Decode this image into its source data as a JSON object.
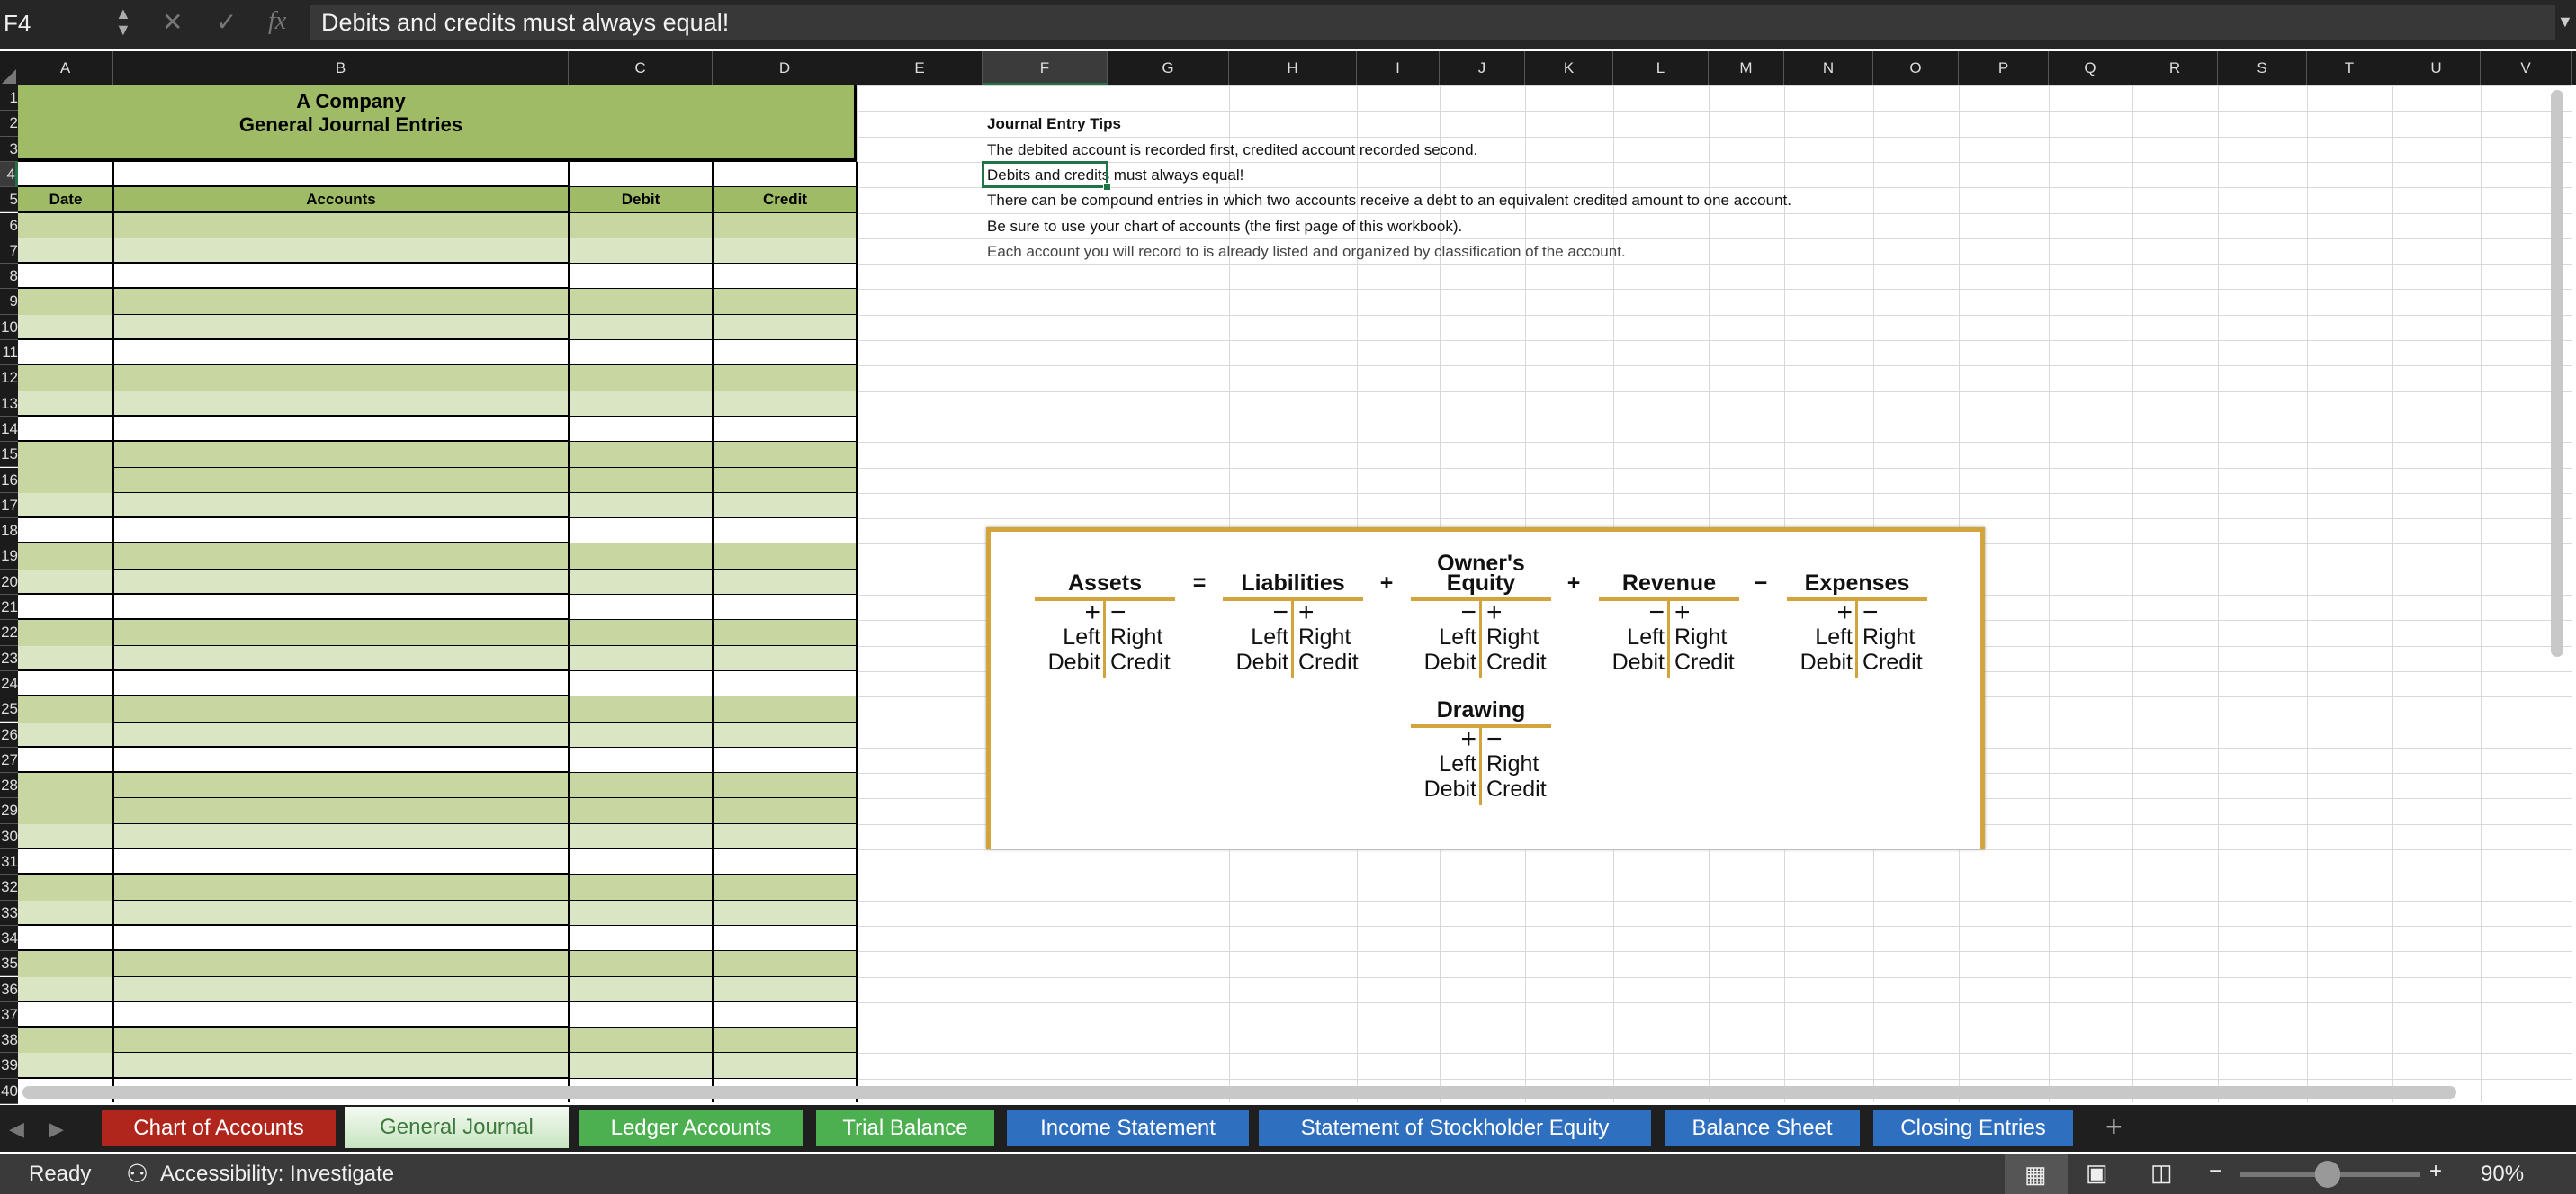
{
  "formula_bar": {
    "name_box": "F4",
    "cancel_icon": "x-icon",
    "enter_icon": "check-icon",
    "fx_label": "fx",
    "formula": "Debits and credits must always equal!"
  },
  "columns": [
    "A",
    "B",
    "C",
    "D",
    "E",
    "F",
    "G",
    "H",
    "I",
    "J",
    "K",
    "L",
    "M",
    "N",
    "O",
    "P",
    "Q",
    "R",
    "S",
    "T",
    "U",
    "V"
  ],
  "rows": [
    "1",
    "2",
    "3",
    "4",
    "5",
    "6",
    "7",
    "8",
    "9",
    "10",
    "11",
    "12",
    "13",
    "14",
    "15",
    "16",
    "17",
    "18",
    "19",
    "20",
    "21",
    "22",
    "23",
    "24",
    "25",
    "26",
    "27",
    "28",
    "29",
    "30",
    "31",
    "32",
    "33",
    "34",
    "35",
    "36",
    "37",
    "38",
    "39",
    "40"
  ],
  "selected_cell": "F4",
  "journal": {
    "company": "A Company",
    "title": "General Journal Entries",
    "headers": {
      "date": "Date",
      "accounts": "Accounts",
      "debit": "Debit",
      "credit": "Credit"
    }
  },
  "colors": {
    "header_green": "#9fbb66",
    "dark_green": "#c8d7a2",
    "light_green": "#dae5c3",
    "selection": "#217346",
    "gold": "#d4a43c"
  },
  "tips": {
    "heading": "Journal Entry Tips",
    "lines": [
      "The debited account is recorded first, credited account recorded second.",
      "Debits and credits must always equal!",
      "There can be compound entries in which two accounts receive a debt to an equivalent credited amount to one account.",
      "Be sure to use your chart of accounts (the first page of this workbook).",
      "Each account you will record to is already listed and organized by classification of the account."
    ]
  },
  "diagram": {
    "accounts": [
      {
        "name": "Assets",
        "left_sign": "+",
        "right_sign": "−",
        "left": "Left",
        "right": "Right",
        "left_side": "Debit",
        "right_side": "Credit"
      },
      {
        "name": "Liabilities",
        "left_sign": "−",
        "right_sign": "+",
        "left": "Left",
        "right": "Right",
        "left_side": "Debit",
        "right_side": "Credit"
      },
      {
        "name_line1": "Owner's",
        "name": "Equity",
        "left_sign": "−",
        "right_sign": "+",
        "left": "Left",
        "right": "Right",
        "left_side": "Debit",
        "right_side": "Credit"
      },
      {
        "name": "Revenue",
        "left_sign": "−",
        "right_sign": "+",
        "left": "Left",
        "right": "Right",
        "left_side": "Debit",
        "right_side": "Credit"
      },
      {
        "name": "Expenses",
        "left_sign": "+",
        "right_sign": "−",
        "left": "Left",
        "right": "Right",
        "left_side": "Debit",
        "right_side": "Credit"
      },
      {
        "name": "Drawing",
        "left_sign": "+",
        "right_sign": "−",
        "left": "Left",
        "right": "Right",
        "left_side": "Debit",
        "right_side": "Credit"
      }
    ],
    "operators": [
      "=",
      "+",
      "+",
      "−"
    ]
  },
  "sheet_tabs": [
    {
      "label": "Chart of Accounts",
      "color": "#b0261c",
      "active": false
    },
    {
      "label": "General Journal",
      "color": "#cfe8c9",
      "active": true
    },
    {
      "label": "Ledger Accounts",
      "color": "#4caf50",
      "active": false
    },
    {
      "label": "Trial Balance",
      "color": "#4caf50",
      "active": false
    },
    {
      "label": "Income Statement",
      "color": "#2f6fbf",
      "active": false
    },
    {
      "label": "Statement of Stockholder Equity",
      "color": "#2f6fbf",
      "active": false
    },
    {
      "label": "Balance Sheet",
      "color": "#2f6fbf",
      "active": false
    },
    {
      "label": "Closing Entries",
      "color": "#2f6fbf",
      "active": false
    }
  ],
  "add_sheet": "+",
  "status": {
    "ready": "Ready",
    "accessibility": "Accessibility: Investigate",
    "zoom": "90%",
    "zoom_minus": "−",
    "zoom_plus": "+",
    "zoom_level_percent": 90
  }
}
